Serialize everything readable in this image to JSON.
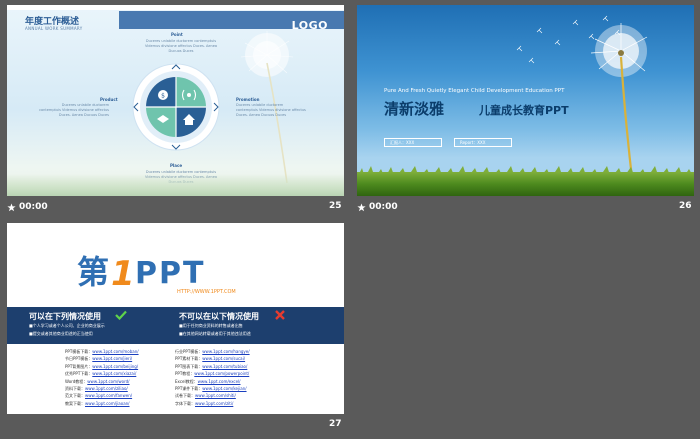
{
  "slides": [
    {
      "number": "25",
      "time": "00:00",
      "title": "年度工作概述",
      "subtitle": "ANNUAL WORK SUMMARY",
      "logo": "LOGO",
      "labels": {
        "top": "Point",
        "left": "Product",
        "right": "Promotion",
        "bottom": "Place"
      },
      "desc": "Duceres unlabile ductorem contemptuis Videmus divisione affectus Duces. Aenea Ducuos Duces",
      "icons": [
        "money-bag-icon",
        "signal-icon",
        "handshake-icon",
        "house-icon"
      ],
      "colors": {
        "circle_blue": "#2a5f95",
        "circle_green": "#6fc4ad",
        "ring": "#dfeef8"
      }
    },
    {
      "number": "26",
      "time": "00:00",
      "en_title": "Pure And Fresh Quietly Elegant Child Development Education PPT",
      "cn_title_1": "清新淡雅",
      "cn_title_2": "儿童成长教育PPT",
      "button_1": "汇报人：XXX",
      "button_2": "Report：XXX"
    },
    {
      "number": "27",
      "brand_text": "第1PPT",
      "brand_url": "HTTP://WWW.1PPT.COM",
      "left_head": "可以在下列情况使用",
      "left_lines": [
        "■个人学习或者个人公司、企业的商业展示",
        "■提交或者其他商业用途的正当使用"
      ],
      "right_head": "不可以在以下情况使用",
      "right_lines": [
        "■用于任何商业资料的转售或者出售",
        "■在其他网站转载或者用于其他违法用途"
      ],
      "links_left": [
        [
          "PPT模板下载：",
          "www.1ppt.com/moban/"
        ],
        [
          "节日PPT模板：",
          "www.1ppt.com/jieri/"
        ],
        [
          "PPT背景图片：",
          "www.1ppt.com/beijing/"
        ],
        [
          "优秀PPT下载：",
          "www.1ppt.com/xiazai/"
        ],
        [
          "Word教程：",
          "www.1ppt.com/word/"
        ],
        [
          "资料下载：",
          "www.1ppt.com/ziliao/"
        ],
        [
          "范文下载：",
          "www.1ppt.com/fanwen/"
        ],
        [
          "教案下载：",
          "www.1ppt.com/jiaoan/"
        ]
      ],
      "links_right": [
        [
          "行业PPT模板：",
          "www.1ppt.com/hangye/"
        ],
        [
          "PPT素材下载：",
          "www.1ppt.com/sucai/"
        ],
        [
          "PPT图表下载：",
          "www.1ppt.com/tubiao/"
        ],
        [
          "PPT教程：",
          "www.1ppt.com/powerpoint/"
        ],
        [
          "Excel教程：",
          "www.1ppt.com/excel/"
        ],
        [
          "PPT课件下载：",
          "www.1ppt.com/kejian/"
        ],
        [
          "试卷下载：",
          "www.1ppt.com/shiti/"
        ],
        [
          "字体下载：",
          "www.1ppt.com/ziti/"
        ]
      ]
    }
  ]
}
